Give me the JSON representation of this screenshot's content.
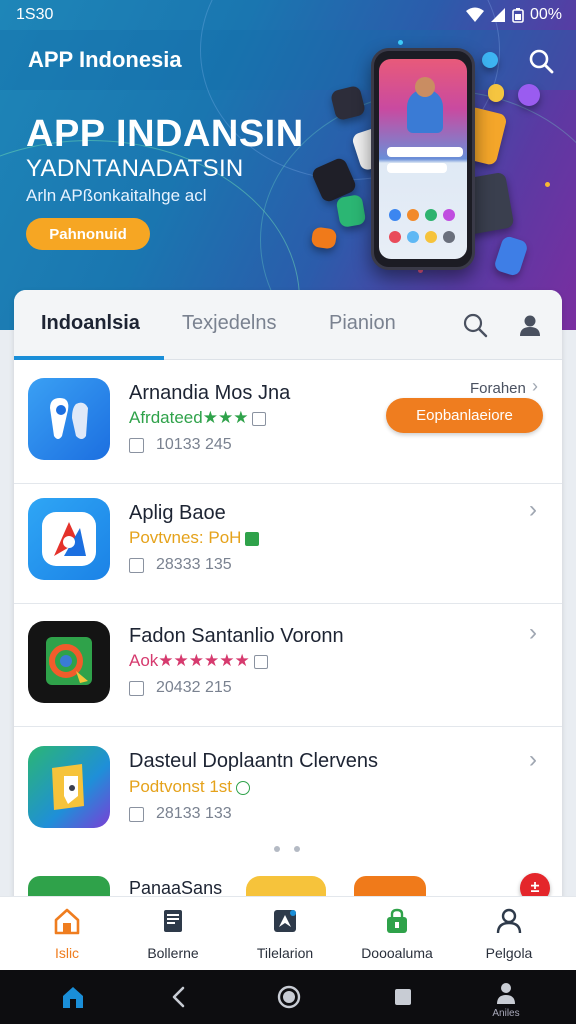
{
  "status_bar": {
    "time": "1S30",
    "battery": "00%"
  },
  "header": {
    "app_title": "APP Indonesia"
  },
  "hero": {
    "title": "APP INDANSIN",
    "subtitle": "YADNTANADATSIN",
    "tagline": "Arln APßonkaitalhge acl",
    "button_label": "Pahnonuid"
  },
  "tabs": [
    {
      "label": "Indoanlsia",
      "active": true
    },
    {
      "label": "Texjedelns",
      "active": false
    },
    {
      "label": "Pianion",
      "active": false
    }
  ],
  "apps": [
    {
      "name": "Arnandia Mos Jna",
      "subtitle": "Afrdateed★★★",
      "count": "10133 245",
      "right_label": "Forahen",
      "action_label": "Eopbanlaeiore",
      "accent": "#2fa24a"
    },
    {
      "name": "Aplig Baoe",
      "subtitle": "Povtvnes: PoH",
      "count": "28333 135",
      "accent": "#e5a21b"
    },
    {
      "name": "Fadon Santanlio Voronn",
      "subtitle": "Aok★★★★★★",
      "count": "20432 215",
      "accent": "#d63a6e"
    },
    {
      "name": "Dasteul Doplaantn Clervens",
      "subtitle": "Podtvonst 1st",
      "count": "28133 133",
      "accent": "#e5a21b"
    },
    {
      "name": "PanaaSans"
    }
  ],
  "fab_label": "±",
  "bottom_nav": [
    {
      "label": "Islic",
      "icon": "home-icon",
      "active": true
    },
    {
      "label": "Bollerne",
      "icon": "book-icon",
      "active": false
    },
    {
      "label": "Tilelarion",
      "icon": "compass-icon",
      "active": false
    },
    {
      "label": "Doooaluma",
      "icon": "lock-bag-icon",
      "active": false
    },
    {
      "label": "Pelgola",
      "icon": "person-icon",
      "active": false
    }
  ],
  "system_nav": {
    "profile_label": "Aniles"
  },
  "colors": {
    "accent_orange": "#ef7d1f",
    "tab_underline": "#1a8ed8",
    "hero_gradient_start": "#1e86b8",
    "hero_gradient_end": "#7a2ea0"
  }
}
